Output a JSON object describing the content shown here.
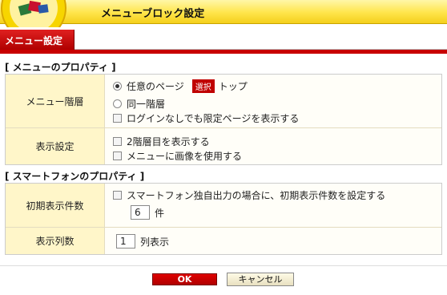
{
  "header": {
    "title": "メニューブロック設定"
  },
  "tab": {
    "label": "メニュー設定"
  },
  "menu_props": {
    "heading": "[ メニューのプロパティ ]",
    "hierarchy": {
      "label": "メニュー階層",
      "option_arbitrary": "任意のページ",
      "select_button": "選択",
      "selected_page": "トップ",
      "option_same": "同一階層",
      "restricted_check": "ログインなしでも限定ページを表示する"
    },
    "display": {
      "label": "表示設定",
      "second_level": "2階層目を表示する",
      "use_image": "メニューに画像を使用する"
    }
  },
  "smartphone_props": {
    "heading": "[ スマートフォンのプロパティ ]",
    "initial_count": {
      "label": "初期表示件数",
      "check": "スマートフォン独自出力の場合に、初期表示件数を設定する",
      "value": "6",
      "unit": "件"
    },
    "columns": {
      "label": "表示列数",
      "value": "1",
      "unit": "列表示"
    }
  },
  "buttons": {
    "ok": "OK",
    "cancel": "キャンセル"
  }
}
